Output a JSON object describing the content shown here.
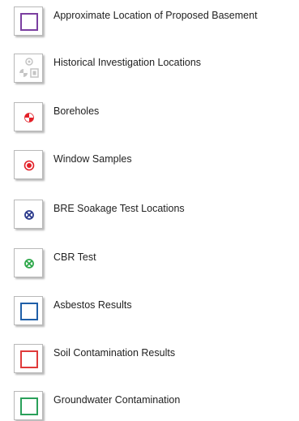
{
  "legend": {
    "items": [
      {
        "label": "Approximate Location of Proposed Basement",
        "icon": "purple-square-outline-icon",
        "color": "#7b3fa0"
      },
      {
        "label": "Historical Investigation Locations",
        "icon": "grey-historical-symbols-icon",
        "color": "#b8b8b8"
      },
      {
        "label": "Boreholes",
        "icon": "borehole-quartered-circle-icon",
        "color": "#e32028"
      },
      {
        "label": "Window Samples",
        "icon": "window-sample-dot-circle-icon",
        "color": "#e32028"
      },
      {
        "label": "BRE Soakage Test Locations",
        "icon": "soakage-crossed-circle-icon",
        "color": "#2b3a8c"
      },
      {
        "label": "CBR Test",
        "icon": "cbr-crossed-circle-icon",
        "color": "#2ea84a"
      },
      {
        "label": "Asbestos Results",
        "icon": "blue-square-outline-icon",
        "color": "#1f5fa8"
      },
      {
        "label": "Soil Contamination Results",
        "icon": "red-square-outline-icon",
        "color": "#e03a3a"
      },
      {
        "label": "Groundwater Contamination",
        "icon": "green-square-outline-icon",
        "color": "#2aa05a"
      }
    ]
  }
}
